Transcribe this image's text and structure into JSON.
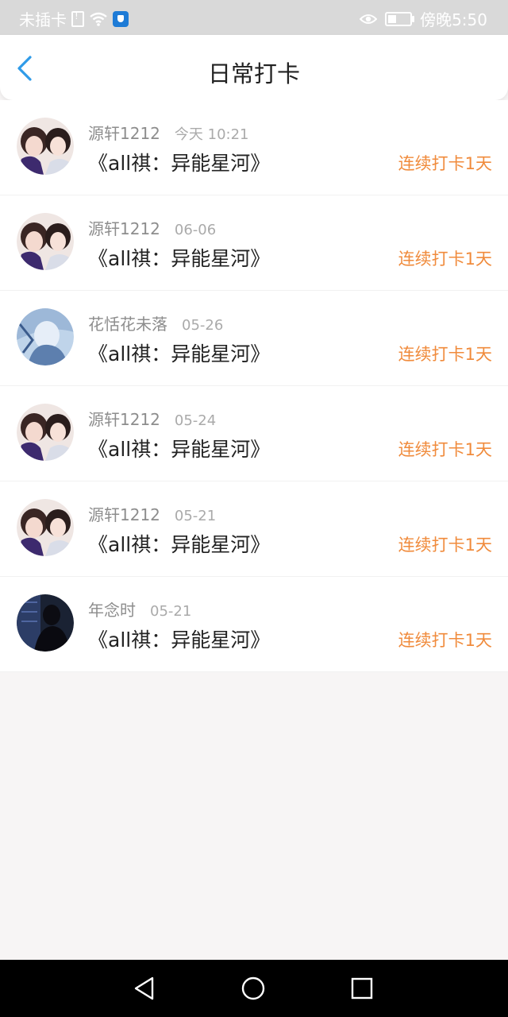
{
  "status_bar": {
    "carrier": "未插卡",
    "time": "傍晚5:50"
  },
  "header": {
    "title": "日常打卡"
  },
  "entries": [
    {
      "user": "源轩1212",
      "time": "今天 10:21",
      "title": "《all祺：异能星河》",
      "streak": "连续打卡1天",
      "avatar": "photo-avatar-a"
    },
    {
      "user": "源轩1212",
      "time": "06-06",
      "title": "《all祺：异能星河》",
      "streak": "连续打卡1天",
      "avatar": "photo-avatar-a"
    },
    {
      "user": "花恬花未落",
      "time": "05-26",
      "title": "《all祺：异能星河》",
      "streak": "连续打卡1天",
      "avatar": "photo-avatar-b"
    },
    {
      "user": "源轩1212",
      "time": "05-24",
      "title": "《all祺：异能星河》",
      "streak": "连续打卡1天",
      "avatar": "photo-avatar-a"
    },
    {
      "user": "源轩1212",
      "time": "05-21",
      "title": "《all祺：异能星河》",
      "streak": "连续打卡1天",
      "avatar": "photo-avatar-a"
    },
    {
      "user": "年念时",
      "time": "05-21",
      "title": "《all祺：异能星河》",
      "streak": "连续打卡1天",
      "avatar": "photo-avatar-c"
    }
  ],
  "colors": {
    "accent_back": "#2f9be8",
    "streak": "#f08b3c",
    "status_bar": "#d9d9d9"
  }
}
